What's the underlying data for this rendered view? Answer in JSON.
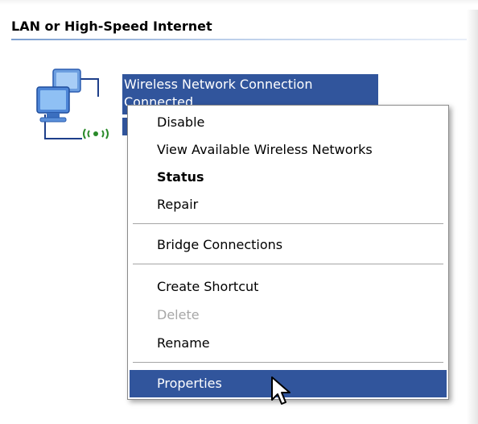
{
  "section": {
    "title": "LAN or High-Speed Internet"
  },
  "connection": {
    "name": "Wireless Network Connection",
    "status": "Connected",
    "icon": "network-connection-icon",
    "wireless_badge": "wireless-signal-icon",
    "selected_color": "#31559c"
  },
  "context_menu": {
    "items": [
      {
        "label": "Disable",
        "state": "normal"
      },
      {
        "label": "View Available Wireless Networks",
        "state": "normal"
      },
      {
        "label": "Status",
        "state": "default"
      },
      {
        "label": "Repair",
        "state": "normal"
      },
      {
        "label": "Bridge Connections",
        "state": "normal"
      },
      {
        "label": "Create Shortcut",
        "state": "normal"
      },
      {
        "label": "Delete",
        "state": "disabled"
      },
      {
        "label": "Rename",
        "state": "normal"
      },
      {
        "label": "Properties",
        "state": "selected"
      }
    ],
    "highlight_color": "#31559c",
    "disabled_color": "#a7a7a7"
  },
  "cursor": {
    "icon": "mouse-pointer-icon"
  }
}
